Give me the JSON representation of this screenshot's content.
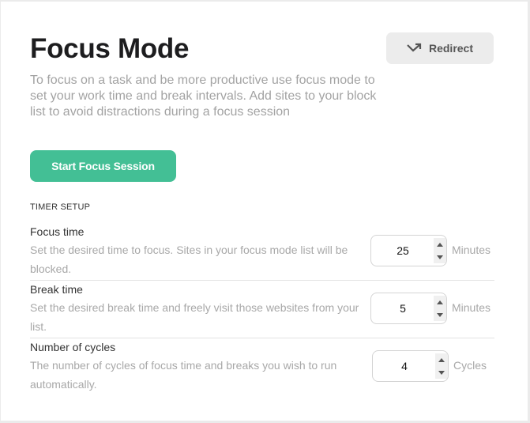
{
  "header": {
    "title": "Focus Mode",
    "redirect_button": {
      "label": "Redirect",
      "icon": "arrow-down-right-up-icon"
    },
    "description": "To focus on a task and be more productive use focus mode to set your work time and break intervals. Add sites to your block list to avoid distractions during a focus session"
  },
  "actions": {
    "start_label": "Start Focus Session",
    "accent_color": "#43bf95"
  },
  "timer_setup": {
    "section_label": "TIMER SETUP",
    "rows": [
      {
        "label": "Focus time",
        "help": "Set the desired time to focus. Sites in your focus mode list will be blocked.",
        "value": "25",
        "unit": "Minutes"
      },
      {
        "label": "Break time",
        "help": "Set the desired break time and freely visit those websites from your list.",
        "value": "5",
        "unit": "Minutes"
      },
      {
        "label": "Number of cycles",
        "help": "The number of cycles of focus time and breaks you wish to run automatically.",
        "value": "4",
        "unit": "Cycles"
      }
    ]
  }
}
